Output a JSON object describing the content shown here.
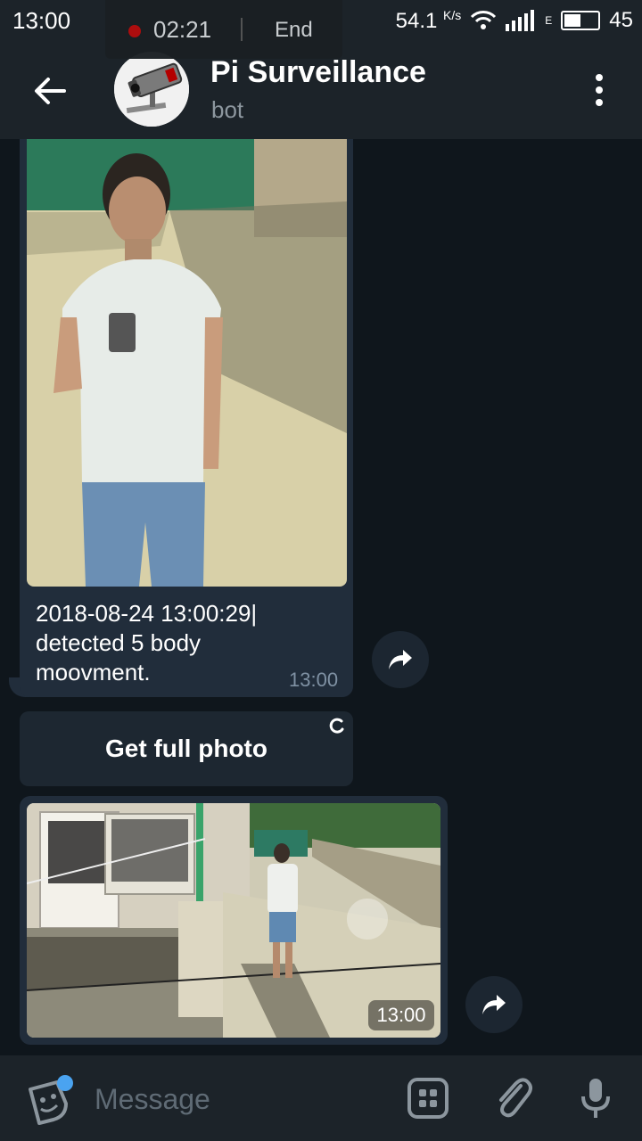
{
  "status_bar": {
    "time": "13:00",
    "call_timer": "02:21",
    "call_end": "End",
    "net_speed": "54.1",
    "net_speed_unit": "K/s",
    "network_type": "E",
    "battery_level": "45"
  },
  "header": {
    "title": "Pi Surveillance",
    "subtitle": "bot"
  },
  "messages": [
    {
      "caption": "2018-08-24 13:00:29|\ndetected 5 body\nmoovment.",
      "time": "13:00"
    },
    {
      "time": "13:00"
    }
  ],
  "keyboard": {
    "button_label": "Get full photo"
  },
  "composer": {
    "placeholder": "Message"
  },
  "colors": {
    "bg": "#0f161c",
    "bar": "#1c2329",
    "bubble": "#212d3b",
    "accent": "#4aa3f0"
  }
}
